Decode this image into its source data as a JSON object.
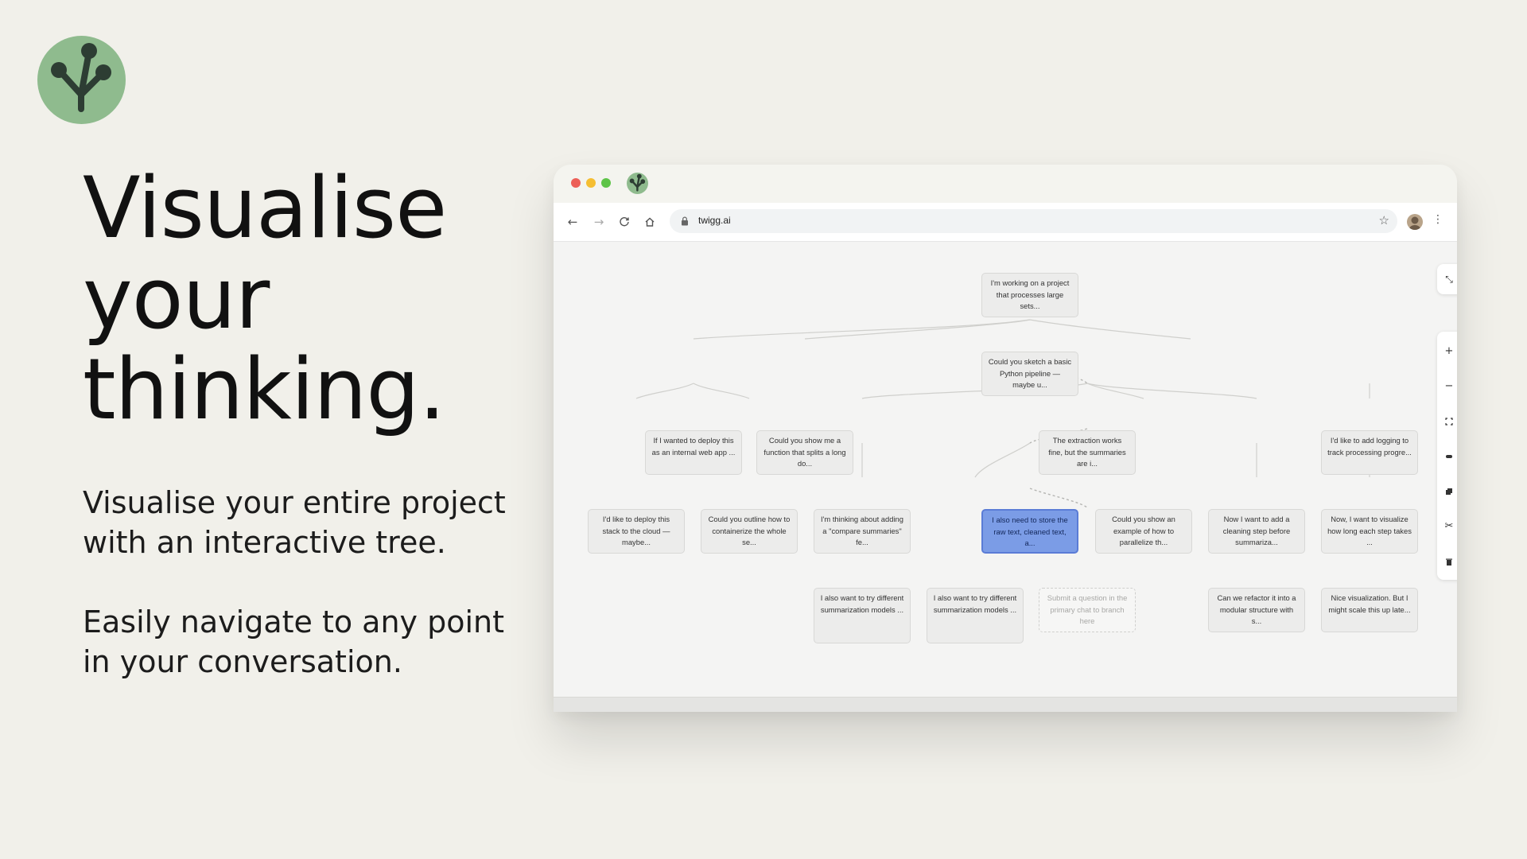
{
  "hero": {
    "headline": [
      "Visualise",
      "your",
      "thinking."
    ],
    "paragraphs": [
      "Visualise your entire project with an interactive tree.",
      "Easily navigate to any point in your conversation."
    ]
  },
  "colors": {
    "background": "#f1f0ea",
    "logo_green": "#8fbb8e",
    "logo_dark": "#2d3d33",
    "selected_node": "#7b9ce6"
  },
  "browser": {
    "url": "twigg.ai",
    "icons": {
      "back": "arrow-left-icon",
      "forward": "arrow-right-icon",
      "reload": "reload-icon",
      "home": "home-icon",
      "lock": "lock-icon",
      "bookmark": "star-icon",
      "menu": "kebab-icon"
    }
  },
  "tree": {
    "nodes": [
      {
        "id": "n1",
        "text": "I'm working on a project that processes large sets...",
        "state": "normal"
      },
      {
        "id": "n2",
        "text": "Could you sketch a basic Python pipeline — maybe u...",
        "state": "normal"
      },
      {
        "id": "n3",
        "text": "If I wanted to deploy this as an internal web app ...",
        "state": "normal"
      },
      {
        "id": "n4",
        "text": "Could you show me a function that splits a long do...",
        "state": "normal"
      },
      {
        "id": "n5",
        "text": "The extraction works fine, but the summaries are i...",
        "state": "normal"
      },
      {
        "id": "n6",
        "text": "I'd like to add logging to track processing progre...",
        "state": "normal"
      },
      {
        "id": "n7",
        "text": "I'd like to deploy this stack to the cloud — maybe...",
        "state": "normal"
      },
      {
        "id": "n8",
        "text": "Could you outline how to containerize the whole se...",
        "state": "normal"
      },
      {
        "id": "n9",
        "text": "I'm thinking about adding a \"compare summaries\" fe...",
        "state": "normal"
      },
      {
        "id": "n10",
        "text": "I also need to store the raw text, cleaned text, a...",
        "state": "selected"
      },
      {
        "id": "n11",
        "text": "Could you show an example of how to parallelize th...",
        "state": "normal"
      },
      {
        "id": "n12",
        "text": "Now I want to add a cleaning step before summariza...",
        "state": "normal"
      },
      {
        "id": "n13",
        "text": "Now, I want to visualize how long each step takes ...",
        "state": "normal"
      },
      {
        "id": "n14",
        "text": "I also want to try different summarization models ...",
        "state": "normal"
      },
      {
        "id": "n15",
        "text": "I also want to try different summarization models ...",
        "state": "normal"
      },
      {
        "id": "n16",
        "text": "Submit a question in the primary chat to branch here",
        "state": "ghost"
      },
      {
        "id": "n17",
        "text": "Can we refactor it into a modular structure with s...",
        "state": "normal"
      },
      {
        "id": "n18",
        "text": "Nice visualization. But I might scale this up late...",
        "state": "normal"
      }
    ],
    "controls": {
      "collapse": "collapse-arrows-icon",
      "zoom_in": "+",
      "zoom_out": "−",
      "tools": [
        "fit-view-icon",
        "minimize-icon",
        "copy-icon",
        "cut-icon",
        "trash-icon"
      ]
    }
  }
}
